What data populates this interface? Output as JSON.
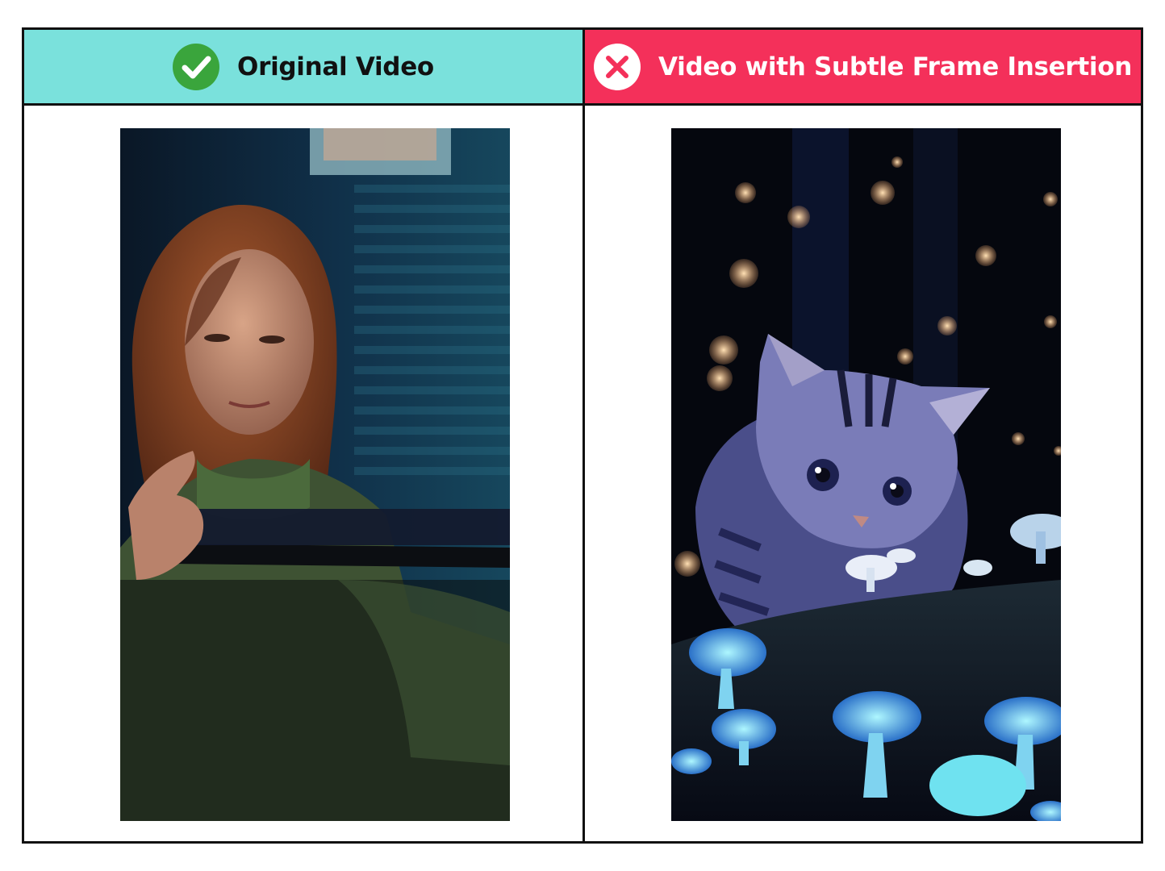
{
  "colors": {
    "original_header_bg": "#7ae1dc",
    "inserted_header_bg": "#f4305a",
    "check_green": "#3aa53c",
    "original_title_color": "#111111",
    "inserted_title_color": "#ffffff"
  },
  "panels": {
    "original": {
      "title": "Original Video",
      "icon": "check-circle-icon"
    },
    "inserted": {
      "title": "Video with Subtle Frame Insertion",
      "icon": "x-circle-icon"
    }
  }
}
